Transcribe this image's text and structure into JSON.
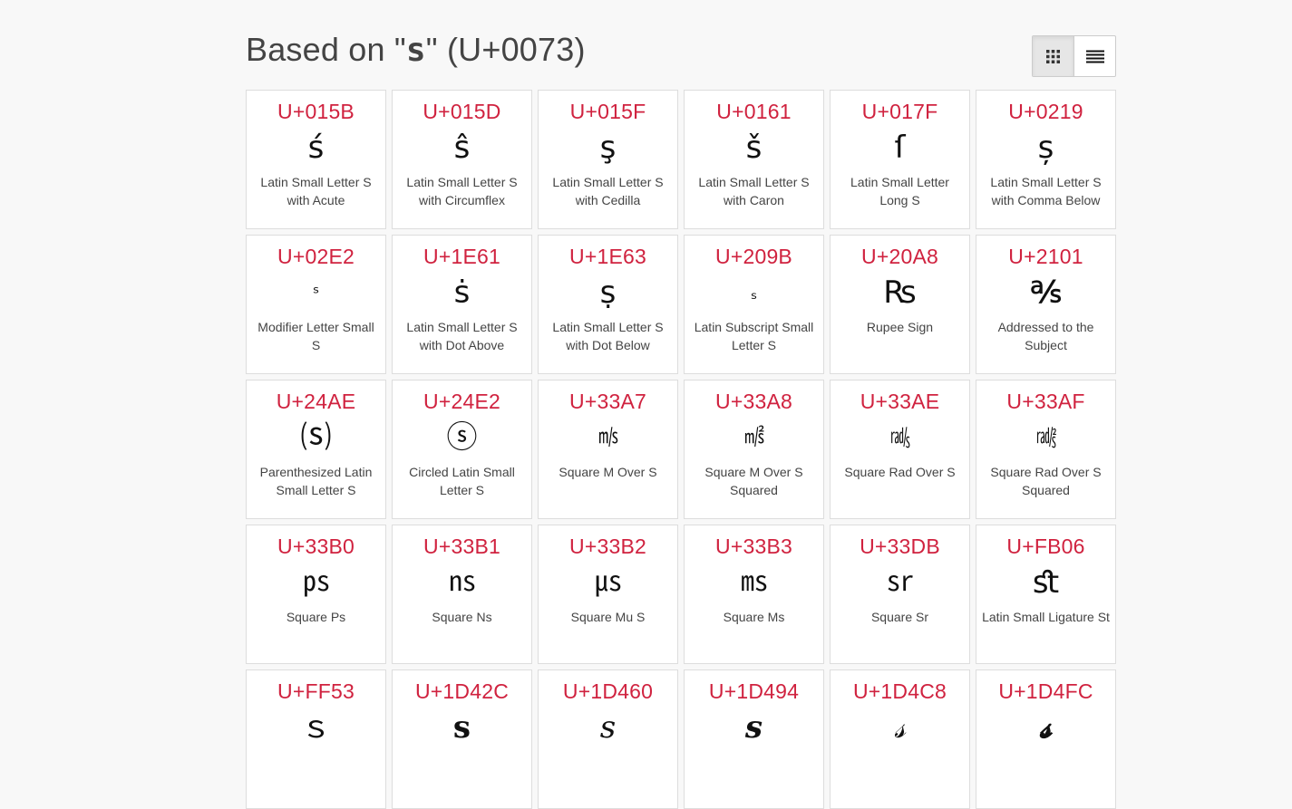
{
  "header": {
    "title_prefix": "Based on \"",
    "base_char": "s",
    "title_suffix": "\" (U+0073)"
  },
  "view_toggle": {
    "grid_icon": "grid-view-icon",
    "list_icon": "list-view-icon",
    "active": "grid"
  },
  "colors": {
    "code": "#d0223f",
    "background": "#f8f8f8",
    "card_border": "#dddddd"
  },
  "cards": [
    {
      "code": "U+015B",
      "glyph": "ś",
      "name": "Latin Small Letter S with Acute"
    },
    {
      "code": "U+015D",
      "glyph": "ŝ",
      "name": "Latin Small Letter S with Circumflex"
    },
    {
      "code": "U+015F",
      "glyph": "ş",
      "name": "Latin Small Letter S with Cedilla"
    },
    {
      "code": "U+0161",
      "glyph": "š",
      "name": "Latin Small Letter S with Caron"
    },
    {
      "code": "U+017F",
      "glyph": "ſ",
      "name": "Latin Small Letter Long S"
    },
    {
      "code": "U+0219",
      "glyph": "ș",
      "name": "Latin Small Letter S with Comma Below"
    },
    {
      "code": "U+02E2",
      "glyph": "ˢ",
      "name": "Modifier Letter Small S"
    },
    {
      "code": "U+1E61",
      "glyph": "ṡ",
      "name": "Latin Small Letter S with Dot Above"
    },
    {
      "code": "U+1E63",
      "glyph": "ṣ",
      "name": "Latin Small Letter S with Dot Below"
    },
    {
      "code": "U+209B",
      "glyph": "ₛ",
      "name": "Latin Subscript Small Letter S"
    },
    {
      "code": "U+20A8",
      "glyph": "₨",
      "name": "Rupee Sign"
    },
    {
      "code": "U+2101",
      "glyph": "℁",
      "name": "Addressed to the Subject"
    },
    {
      "code": "U+24AE",
      "glyph": "⒮",
      "name": "Parenthesized Latin Small Letter S"
    },
    {
      "code": "U+24E2",
      "glyph": "ⓢ",
      "name": "Circled Latin Small Letter S"
    },
    {
      "code": "U+33A7",
      "glyph": "㎧",
      "name": "Square M Over S"
    },
    {
      "code": "U+33A8",
      "glyph": "㎨",
      "name": "Square M Over S Squared"
    },
    {
      "code": "U+33AE",
      "glyph": "㎮",
      "name": "Square Rad Over S"
    },
    {
      "code": "U+33AF",
      "glyph": "㎯",
      "name": "Square Rad Over S Squared"
    },
    {
      "code": "U+33B0",
      "glyph": "㎰",
      "name": "Square Ps"
    },
    {
      "code": "U+33B1",
      "glyph": "㎱",
      "name": "Square Ns"
    },
    {
      "code": "U+33B2",
      "glyph": "㎲",
      "name": "Square Mu S"
    },
    {
      "code": "U+33B3",
      "glyph": "㎳",
      "name": "Square Ms"
    },
    {
      "code": "U+33DB",
      "glyph": "㏛",
      "name": "Square Sr"
    },
    {
      "code": "U+FB06",
      "glyph": "ﬆ",
      "name": "Latin Small Ligature St"
    },
    {
      "code": "U+FF53",
      "glyph": "ｓ",
      "name": ""
    },
    {
      "code": "U+1D42C",
      "glyph": "𝐬",
      "name": ""
    },
    {
      "code": "U+1D460",
      "glyph": "𝑠",
      "name": ""
    },
    {
      "code": "U+1D494",
      "glyph": "𝒔",
      "name": ""
    },
    {
      "code": "U+1D4C8",
      "glyph": "𝓈",
      "name": ""
    },
    {
      "code": "U+1D4FC",
      "glyph": "𝓼",
      "name": ""
    }
  ]
}
